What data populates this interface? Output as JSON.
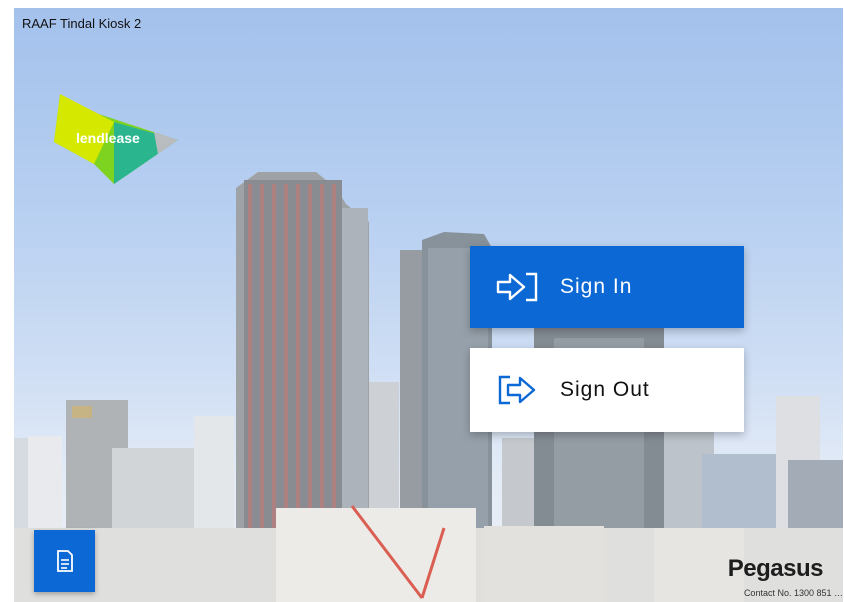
{
  "header": {
    "kiosk_name": "RAAF Tindal Kiosk 2"
  },
  "logo": {
    "text": "lendlease",
    "colors": [
      "#7ed321",
      "#c6e600",
      "#1fb48c"
    ]
  },
  "actions": [
    {
      "label": "Sign In",
      "icon": "sign-in-icon"
    },
    {
      "label": "Sign Out",
      "icon": "sign-out-icon"
    }
  ],
  "document_button": {
    "icon": "document-icon"
  },
  "footer": {
    "brand": "Pegasus",
    "contact": "Contact No. 1300 851 …"
  },
  "colors": {
    "primary": "#0b68d4",
    "background_sky": "#a9c6ee",
    "button_light": "#ffffff"
  }
}
